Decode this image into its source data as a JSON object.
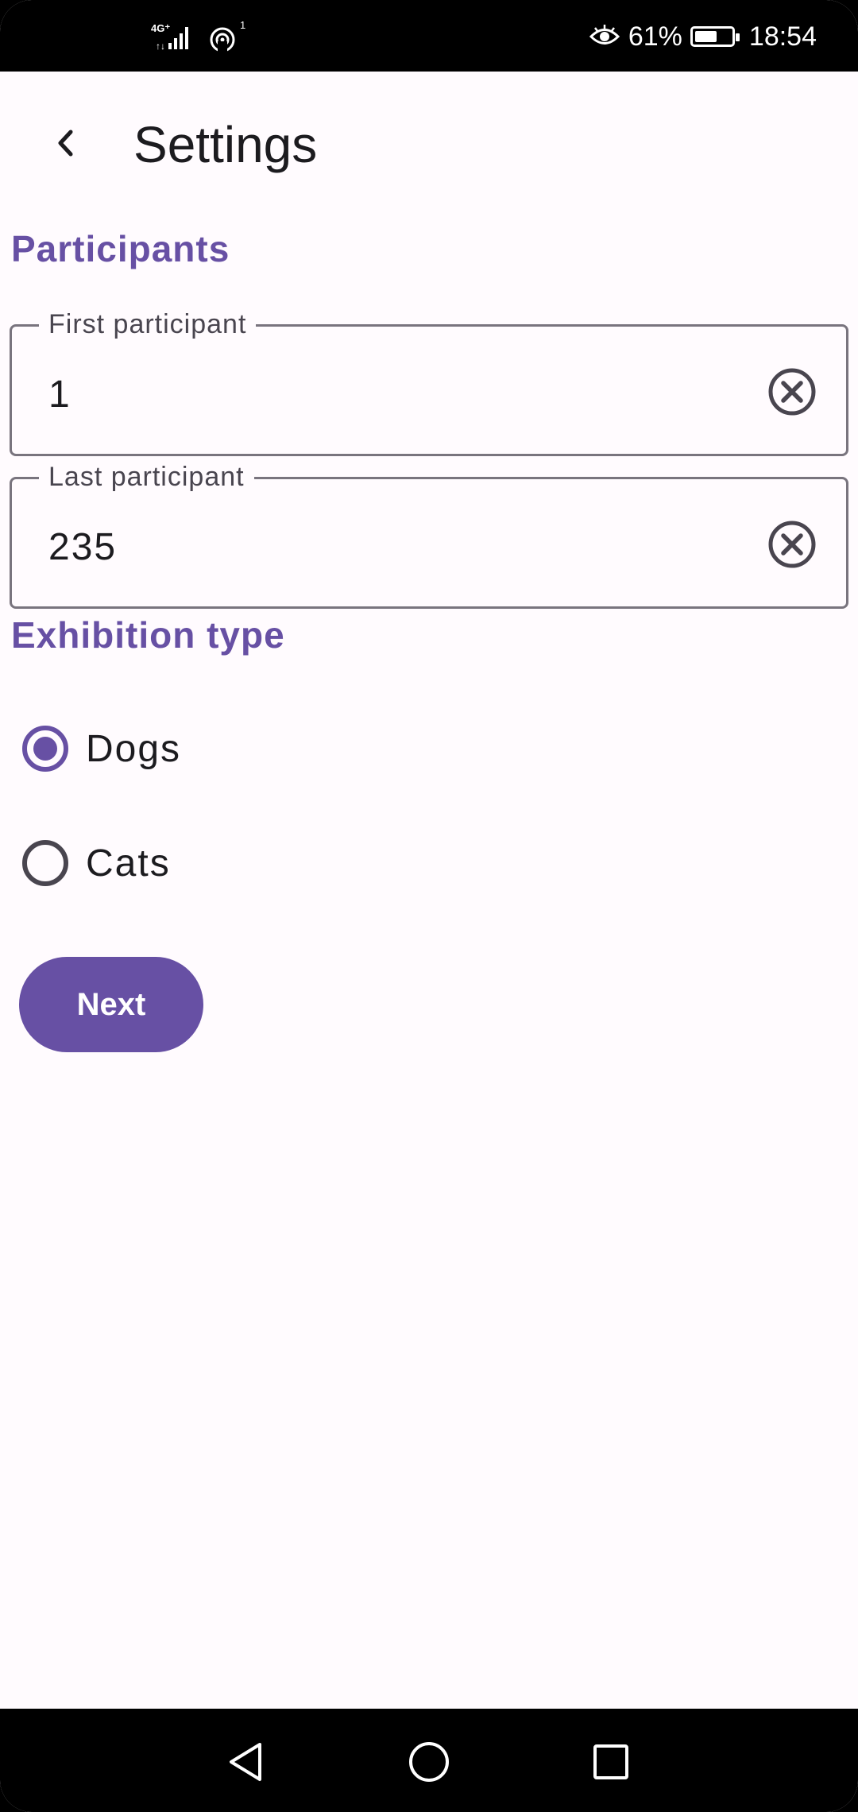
{
  "status_bar": {
    "network": "4G",
    "sim_indicator": "1",
    "battery_level": 61,
    "battery_text": "61%",
    "time": "18:54",
    "icons": [
      "signal-icon",
      "hotspot-icon",
      "eye-comfort-icon",
      "battery-icon"
    ]
  },
  "app_bar": {
    "title": "Settings",
    "back_icon": "chevron-left-icon"
  },
  "participants": {
    "section_title": "Participants",
    "first": {
      "label": "First participant",
      "value": "1",
      "clear_icon": "clear-circle-icon"
    },
    "last": {
      "label": "Last participant",
      "value": "235",
      "clear_icon": "clear-circle-icon"
    }
  },
  "exhibition": {
    "section_title": "Exhibition type",
    "options": [
      {
        "label": "Dogs",
        "selected": true
      },
      {
        "label": "Cats",
        "selected": false
      }
    ]
  },
  "next_button": {
    "label": "Next"
  },
  "nav_bar": {
    "icons": [
      "back-triangle-icon",
      "home-circle-icon",
      "recents-square-icon"
    ]
  },
  "colors": {
    "accent": "#6750a4",
    "background": "#fffbfe",
    "text": "#1c1b1f",
    "outline": "#79747e"
  }
}
